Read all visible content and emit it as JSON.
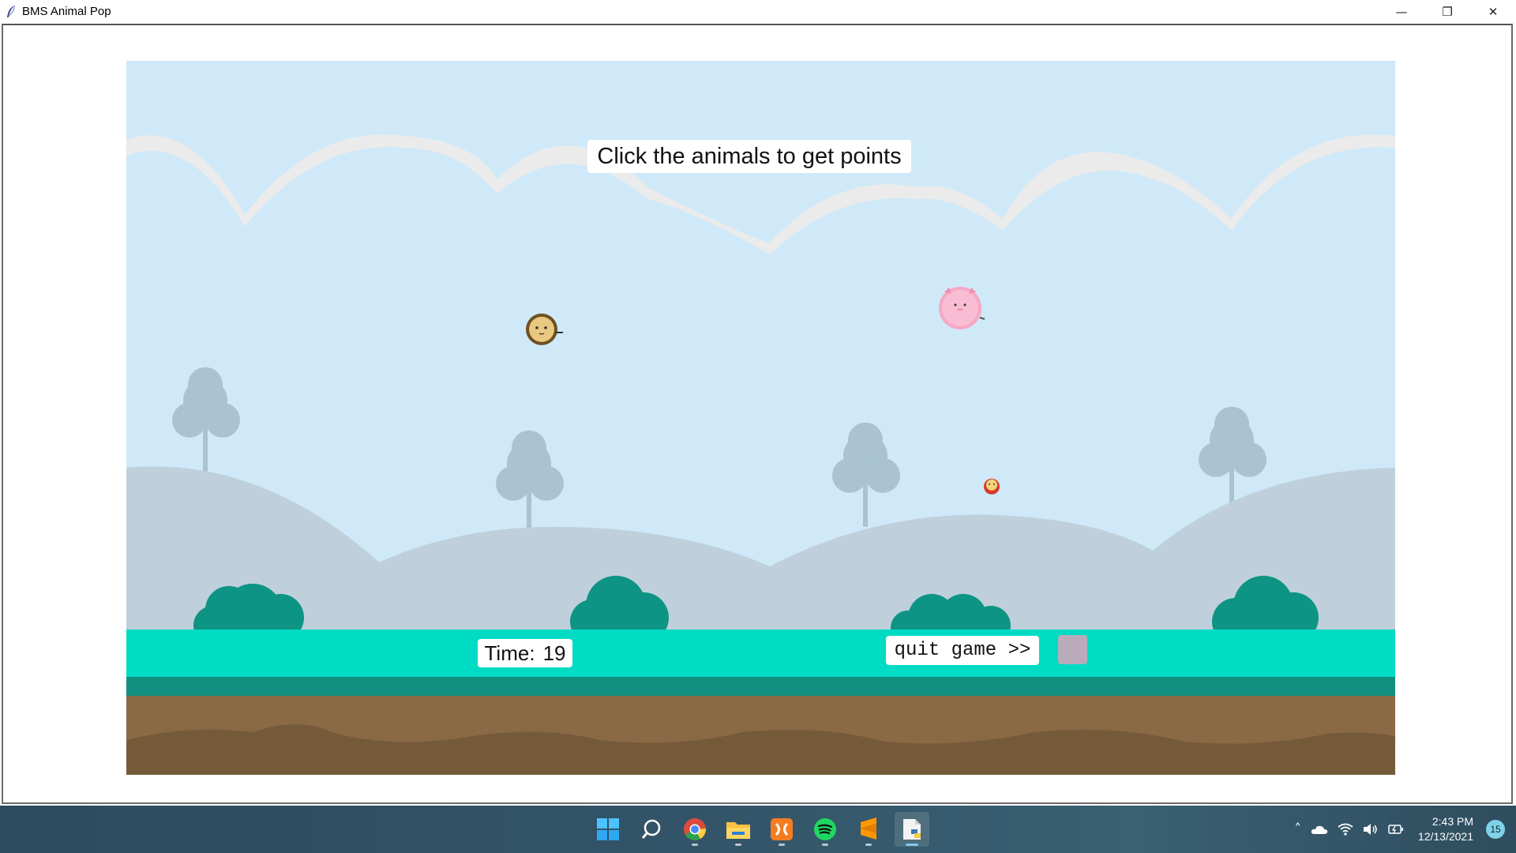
{
  "window": {
    "title": "BMS Animal Pop",
    "minimize_glyph": "—",
    "restore_glyph": "❐",
    "close_glyph": "✕"
  },
  "game": {
    "instruction": "Click the animals to get points",
    "timer_label": "Time:",
    "timer_value": "19",
    "quit_label": "quit game >>",
    "animals": [
      "lion",
      "pig",
      "small-red-animal"
    ]
  },
  "colors": {
    "sky": "#cfe9f8",
    "grass": "#00dcc4",
    "ground": "#8a6a45",
    "bushes": "#0e9484"
  },
  "taskbar": {
    "apps": [
      "start-icon",
      "search-icon",
      "chrome-icon",
      "file-explorer-icon",
      "xampp-icon",
      "spotify-icon",
      "sublime-text-icon",
      "python-idle-icon"
    ],
    "time": "2:43 PM",
    "date": "12/13/2021",
    "notification_count": "15"
  }
}
